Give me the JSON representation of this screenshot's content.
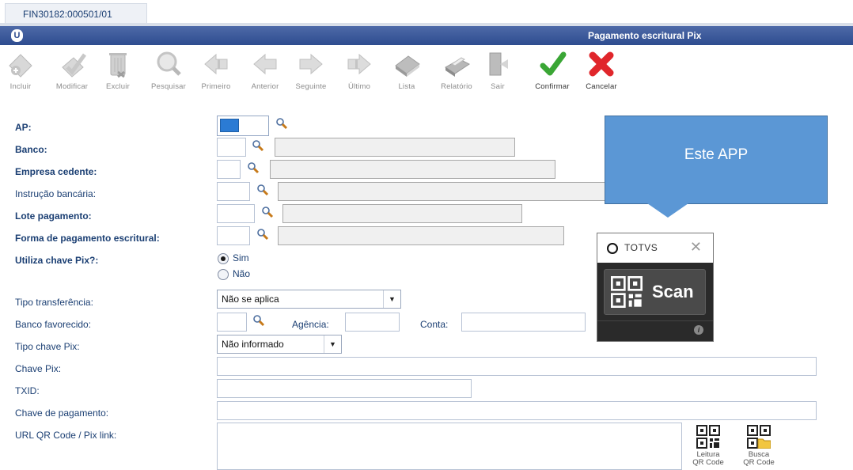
{
  "tab": {
    "label": "FIN30182:000501/01"
  },
  "window": {
    "title": "Pagamento escritural Pix"
  },
  "toolbar": {
    "incluir": "Incluir",
    "modificar": "Modificar",
    "excluir": "Excluir",
    "pesquisar": "Pesquisar",
    "primeiro": "Primeiro",
    "anterior": "Anterior",
    "seguinte": "Seguinte",
    "ultimo": "Último",
    "lista": "Lista",
    "relatorio": "Relatório",
    "sair": "Sair",
    "confirmar": "Confirmar",
    "cancelar": "Cancelar"
  },
  "form": {
    "ap": "AP:",
    "banco": "Banco:",
    "empresa_cedente": "Empresa cedente:",
    "instrucao_bancaria": "Instrução bancária:",
    "lote_pagamento": "Lote pagamento:",
    "forma_pagamento": "Forma de pagamento escritural:",
    "utiliza_chave_pix": "Utiliza chave Pix?:",
    "radio_sim": "Sim",
    "radio_nao": "Não",
    "radio_selected": "Sim",
    "tipo_transferencia": "Tipo transferência:",
    "tipo_transferencia_value": "Não se aplica",
    "banco_favorecido": "Banco favorecido:",
    "agencia": "Agência:",
    "conta": "Conta:",
    "tipo_chave_pix": "Tipo chave Pix:",
    "tipo_chave_pix_value": "Não informado",
    "chave_pix": "Chave Pix:",
    "txid": "TXID:",
    "chave_pagamento": "Chave de pagamento:",
    "url_qr": "URL QR Code / Pix link:"
  },
  "qr_buttons": {
    "leitura_line1": "Leitura",
    "leitura_line2": "QR Code",
    "busca_line1": "Busca",
    "busca_line2": "QR Code"
  },
  "callout": {
    "text": "Este APP"
  },
  "totvs_widget": {
    "brand": "TOTVS",
    "scan_label": "Scan",
    "close": "✕",
    "info": "i"
  },
  "colors": {
    "titlebar": "#2e4c8f",
    "label": "#1b3f73",
    "callout": "#5b97d5",
    "confirm": "#3aa635",
    "cancel": "#e0262b"
  }
}
